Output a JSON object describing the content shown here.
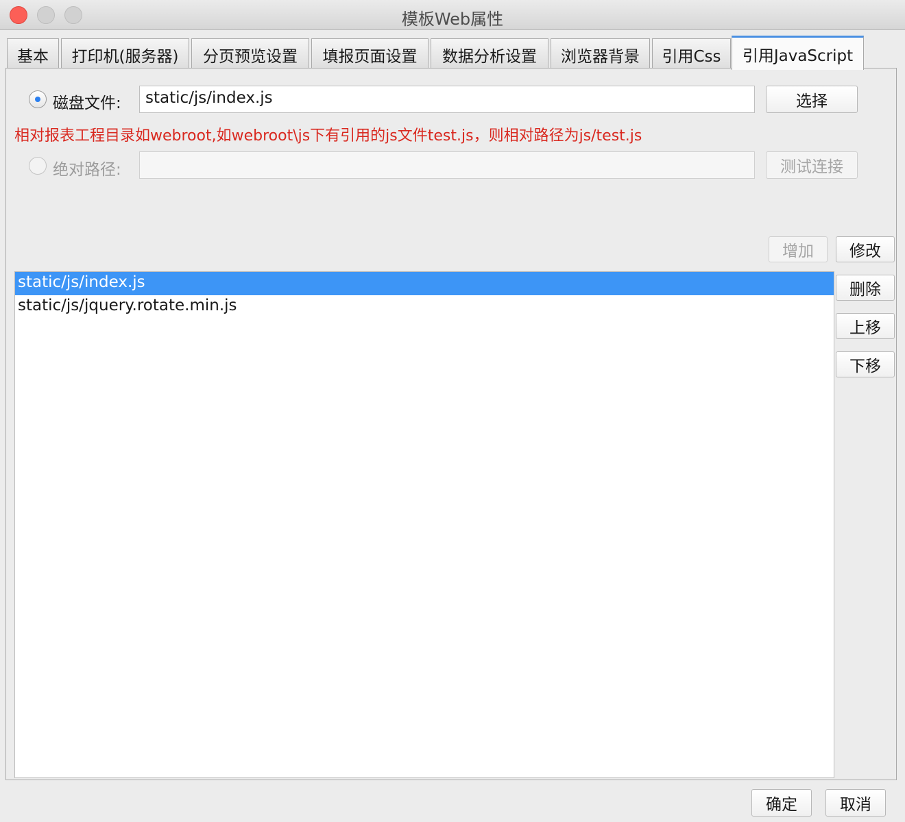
{
  "window": {
    "title": "模板Web属性"
  },
  "tabs": [
    {
      "label": "基本"
    },
    {
      "label": "打印机(服务器)"
    },
    {
      "label": "分页预览设置"
    },
    {
      "label": "填报页面设置"
    },
    {
      "label": "数据分析设置"
    },
    {
      "label": "浏览器背景"
    },
    {
      "label": "引用Css"
    },
    {
      "label": "引用JavaScript",
      "active": true
    }
  ],
  "disk_file": {
    "label": "磁盘文件:",
    "value": "static/js/index.js",
    "selected": true,
    "button": "选择"
  },
  "hint": "相对报表工程目录如webroot,如webroot\\js下有引用的js文件test.js，则相对路径为js/test.js",
  "absolute_path": {
    "label": "绝对路径:",
    "value": "",
    "selected": false,
    "button": "测试连接"
  },
  "list_actions": {
    "add": "增加",
    "modify": "修改",
    "delete": "删除",
    "move_up": "上移",
    "move_down": "下移"
  },
  "file_list": [
    {
      "text": "static/js/index.js",
      "selected": true
    },
    {
      "text": "static/js/jquery.rotate.min.js",
      "selected": false
    }
  ],
  "footer": {
    "ok": "确定",
    "cancel": "取消"
  },
  "colors": {
    "accent": "#3d95f6",
    "hint": "#d9281f",
    "close": "#fc5f57"
  }
}
